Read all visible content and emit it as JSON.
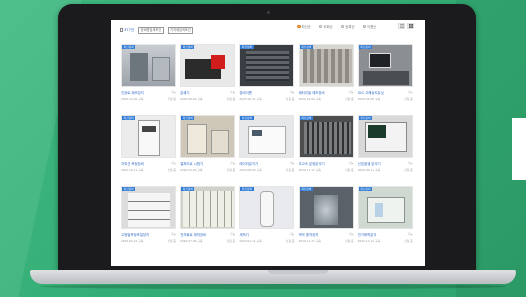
{
  "colors": {
    "background": "#37b078",
    "accent": "#2f68c5",
    "badge": "#2f7bd6",
    "radio_selected": "#e67a17"
  },
  "toolbar": {
    "count": "377건",
    "filters": [
      "장비명검색조건",
      "기자재검색조건"
    ],
    "sort_options": [
      {
        "label": "최신순",
        "selected": true
      },
      {
        "label": "조회순",
        "selected": false
      },
      {
        "label": "등록순",
        "selected": false
      },
      {
        "label": "이름순",
        "selected": false
      }
    ],
    "view_icons": [
      "list-icon",
      "grid-icon"
    ]
  },
  "items": [
    {
      "badge": "최신장비",
      "title": "진공로 제조장치",
      "tag": "가능",
      "date": "2020-10-20 구축",
      "note": "신청 중",
      "img": "grey-rig"
    },
    {
      "badge": "최신장비",
      "title": "분쇄기",
      "tag": "가능",
      "date": "2020-06-09 구축",
      "note": "신청 중",
      "img": "red-machine"
    },
    {
      "badge": "최신장비",
      "title": "장비이름",
      "tag": "가능",
      "date": "2020-10-11 구축",
      "note": "신청 중",
      "img": "rack"
    },
    {
      "badge": "최신장비",
      "title": "배터리셀 제조장비",
      "tag": "가능",
      "date": "2020-10-09 구축",
      "note": "신청 중",
      "img": "cabinet"
    },
    {
      "badge": "최신장비",
      "title": "GIG 고해상도유닛",
      "tag": "가능",
      "date": "2020-02-08 구축",
      "note": "신청 중",
      "img": "monitor-desk"
    },
    {
      "badge": "최신장비",
      "title": "자외선 측정장비",
      "tag": "가능",
      "date": "2020-10-11 구축",
      "note": "신청 중",
      "img": "tall-box"
    },
    {
      "badge": "최신장비",
      "title": "열처리로 시험기",
      "tag": "가능",
      "date": "2020-02-09 구축",
      "note": "신청 중",
      "img": "lab-room"
    },
    {
      "badge": "최신장비",
      "title": "레이저분석기",
      "tag": "가능",
      "date": "2020-08-09 구축",
      "note": "신청 중",
      "img": "white-box"
    },
    {
      "badge": "최신장비",
      "title": "초고속 분광분석기",
      "tag": "가능",
      "date": "2020-11-17 구축",
      "note": "신청 중",
      "img": "console"
    },
    {
      "badge": "최신장비",
      "title": "신호발생 분석기",
      "tag": "가능",
      "date": "2020-09-11 구축",
      "note": "신청 중",
      "img": "oscilloscope"
    },
    {
      "badge": "최신장비",
      "title": "고정밀측정조절장치",
      "tag": "가능",
      "date": "2020-02-15 구축",
      "note": "신청 중",
      "img": "shelves"
    },
    {
      "badge": "최신장비",
      "title": "전자회로 제작장비",
      "tag": "가능",
      "date": "2020-07-06 구축",
      "note": "신청 중",
      "img": "panel-wall"
    },
    {
      "badge": "최신장비",
      "title": "세척기",
      "tag": "가능",
      "date": "2020-01-11 구축",
      "note": "신청 중",
      "img": "white-robot"
    },
    {
      "badge": "최신장비",
      "title": "박막 증착장치",
      "tag": "가능",
      "date": "2020-11-17 구축",
      "note": "신청 중",
      "img": "chamber"
    },
    {
      "badge": "최신장비",
      "title": "전기화학분석",
      "tag": "가능",
      "date": "2020-11-11 구축",
      "note": "신청 중",
      "img": "glassware"
    }
  ]
}
